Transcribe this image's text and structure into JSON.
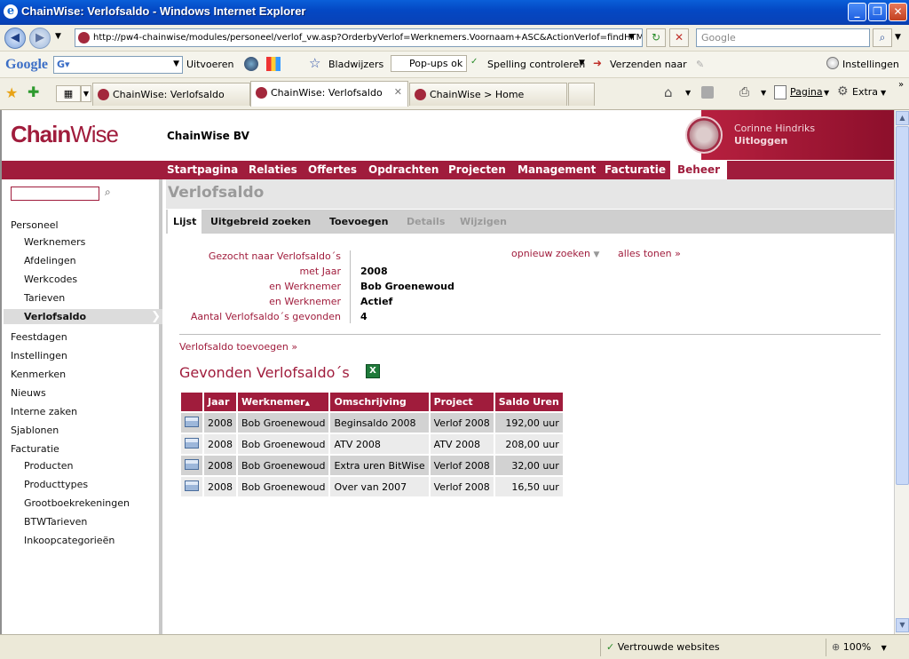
{
  "window": {
    "title": "ChainWise: Verlofsaldo - Windows Internet Explorer"
  },
  "address": {
    "url": "http://pw4-chainwise/modules/personeel/verlof_vw.asp?OrderbyVerlof=Werknemers.Voornaam+ASC&ActionVerlof=findHTM",
    "search_placeholder": "Google"
  },
  "google_bar": {
    "logo": "Google",
    "run": "Uitvoeren",
    "bookmarks": "Bladwijzers",
    "popups": "Pop-ups ok",
    "spelling": "Spelling controleren",
    "send": "Verzenden naar",
    "settings": "Instellingen"
  },
  "tabs": [
    {
      "label": "ChainWise: Verlofsaldo"
    },
    {
      "label": "ChainWise: Verlofsaldo"
    },
    {
      "label": "ChainWise > Home"
    }
  ],
  "cmdbar": {
    "page": "Pagina",
    "extra": "Extra"
  },
  "header": {
    "logo_a": "Chain",
    "logo_b": "Wise",
    "company": "ChainWise BV",
    "user": "Corinne Hindriks",
    "logout": "Uitloggen"
  },
  "mainnav": [
    "Startpagina",
    "Relaties",
    "Offertes",
    "Opdrachten",
    "Projecten",
    "Management",
    "Facturatie",
    "Beheer"
  ],
  "sidebar": {
    "personeel": "Personeel",
    "personeel_items": [
      "Werknemers",
      "Afdelingen",
      "Werkcodes",
      "Tarieven",
      "Verlofsaldo"
    ],
    "main_items": [
      "Feestdagen",
      "Instellingen",
      "Kenmerken",
      "Nieuws",
      "Interne zaken",
      "Sjablonen",
      "Facturatie"
    ],
    "facturatie_items": [
      "Producten",
      "Producttypes",
      "Grootboekrekeningen",
      "BTWTarieven",
      "Inkoopcategorieën"
    ]
  },
  "page": {
    "title": "Verlofsaldo"
  },
  "subnav": [
    "Lijst",
    "Uitgebreid zoeken",
    "Toevoegen",
    "Details",
    "Wijzigen"
  ],
  "criteria": {
    "labels": [
      "Gezocht naar Verlofsaldo´s",
      "met Jaar",
      "en Werknemer",
      "en Werknemer",
      "Aantal Verlofsaldo´s gevonden"
    ],
    "values": [
      "",
      "2008",
      "Bob Groenewoud",
      "Actief",
      "4"
    ],
    "search_again": "opnieuw zoeken",
    "show_all": "alles tonen »"
  },
  "add_link": "Verlofsaldo toevoegen  »",
  "results": {
    "title": "Gevonden Verlofsaldo´s",
    "columns": [
      "",
      "Jaar",
      "Werknemer",
      "Omschrijving",
      "Project",
      "Saldo Uren"
    ],
    "rows": [
      [
        "2008",
        "Bob Groenewoud",
        "Beginsaldo 2008",
        "Verlof 2008",
        "192,00 uur"
      ],
      [
        "2008",
        "Bob Groenewoud",
        "ATV 2008",
        "ATV 2008",
        "208,00 uur"
      ],
      [
        "2008",
        "Bob Groenewoud",
        "Extra uren BitWise",
        "Verlof 2008",
        "32,00 uur"
      ],
      [
        "2008",
        "Bob Groenewoud",
        "Over van 2007",
        "Verlof 2008",
        "16,50 uur"
      ]
    ]
  },
  "statusbar": {
    "zone": "Vertrouwde websites",
    "zoom": "100%"
  }
}
